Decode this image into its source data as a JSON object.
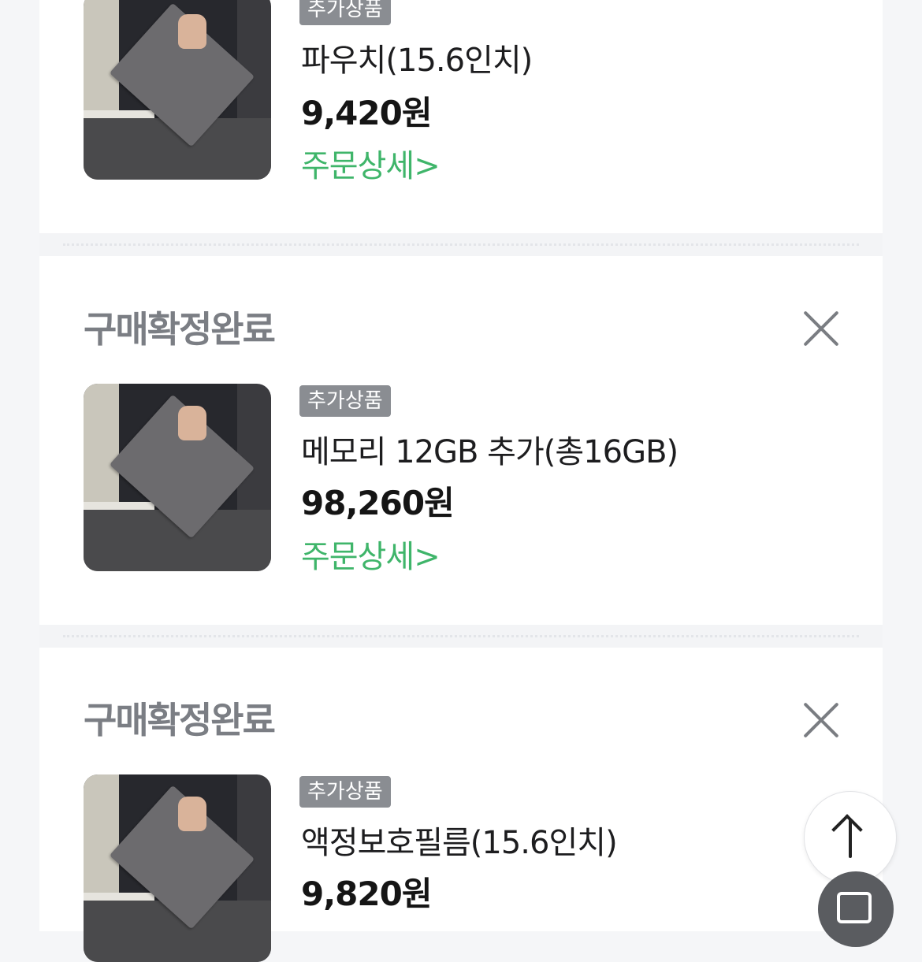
{
  "orders": [
    {
      "badge": "추가상품",
      "name": "파우치(15.6인치)",
      "price": "9,420원",
      "detail_link": "주문상세>"
    },
    {
      "status": "구매확정완료",
      "badge": "추가상품",
      "name": "메모리 12GB 추가(총16GB)",
      "price": "98,260원",
      "detail_link": "주문상세>"
    },
    {
      "status": "구매확정완료",
      "badge": "추가상품",
      "name": "액정보호필름(15.6인치)",
      "price": "9,820원"
    }
  ],
  "colors": {
    "detail_link": "#3fb56a",
    "badge_bg": "#8a8d92",
    "status_text": "#7b7e84"
  },
  "icons": {
    "close": "close-icon",
    "scroll_top": "arrow-up-icon",
    "scan": "scan-icon"
  }
}
